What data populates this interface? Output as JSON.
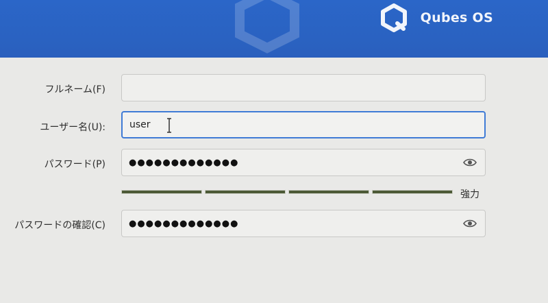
{
  "header": {
    "brand_name": "Qubes OS",
    "logo_icon": "qubes-logo-icon",
    "color": "#2b66c8"
  },
  "form": {
    "fullname": {
      "label": "フルネーム(F)",
      "value": ""
    },
    "username": {
      "label": "ユーザー名(U):",
      "value": "user"
    },
    "password": {
      "label": "パスワード(P)",
      "masked_value": "●●●●●●●●●●●●●"
    },
    "strength": {
      "label": "強力",
      "segments_filled": 4,
      "segments_total": 4
    },
    "confirm": {
      "label": "パスワードの確認(C)",
      "masked_value": "●●●●●●●●●●●●●"
    }
  },
  "icons": [
    "qubes-logo-icon",
    "eye-icon",
    "text-cursor-icon"
  ]
}
